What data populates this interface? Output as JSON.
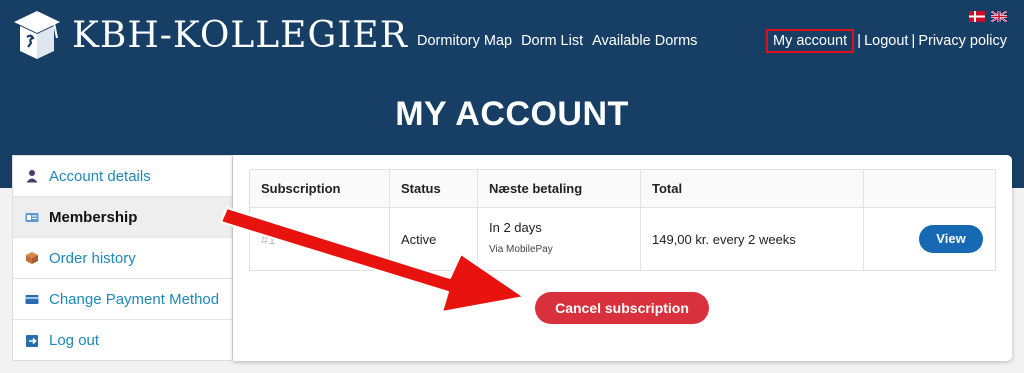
{
  "site": {
    "logo_text": "KBH-KOLLEGIER"
  },
  "nav": {
    "dormitory_map": "Dormitory Map",
    "dorm_list": "Dorm List",
    "available_dorms": "Available Dorms"
  },
  "account_nav": {
    "my_account": "My account",
    "logout": "Logout",
    "privacy_policy": "Privacy policy",
    "separator": "|"
  },
  "flags": [
    "danish-flag-icon",
    "uk-flag-icon"
  ],
  "page": {
    "title": "MY ACCOUNT"
  },
  "sidebar": {
    "items": [
      {
        "label": "Account details",
        "icon": "user-icon",
        "active": false
      },
      {
        "label": "Membership",
        "icon": "card-icon",
        "active": true
      },
      {
        "label": "Order history",
        "icon": "box-icon",
        "active": false
      },
      {
        "label": "Change Payment Method",
        "icon": "credit-card-icon",
        "active": false
      },
      {
        "label": "Log out",
        "icon": "logout-icon",
        "active": false
      }
    ]
  },
  "subscriptions": {
    "headers": [
      "Subscription",
      "Status",
      "Næste betaling",
      "Total"
    ],
    "rows": [
      {
        "id": "#1",
        "status": "Active",
        "next_payment": "In 2 days",
        "next_payment_via": "Via MobilePay",
        "total": "149,00 kr. every 2 weeks",
        "view_label": "View"
      }
    ]
  },
  "actions": {
    "cancel_label": "Cancel subscription"
  },
  "colors": {
    "header_bg": "#173f66",
    "link": "#1e88b8",
    "view_button": "#1769b3",
    "cancel_button": "#d8313d",
    "arrow": "#e8120f"
  }
}
